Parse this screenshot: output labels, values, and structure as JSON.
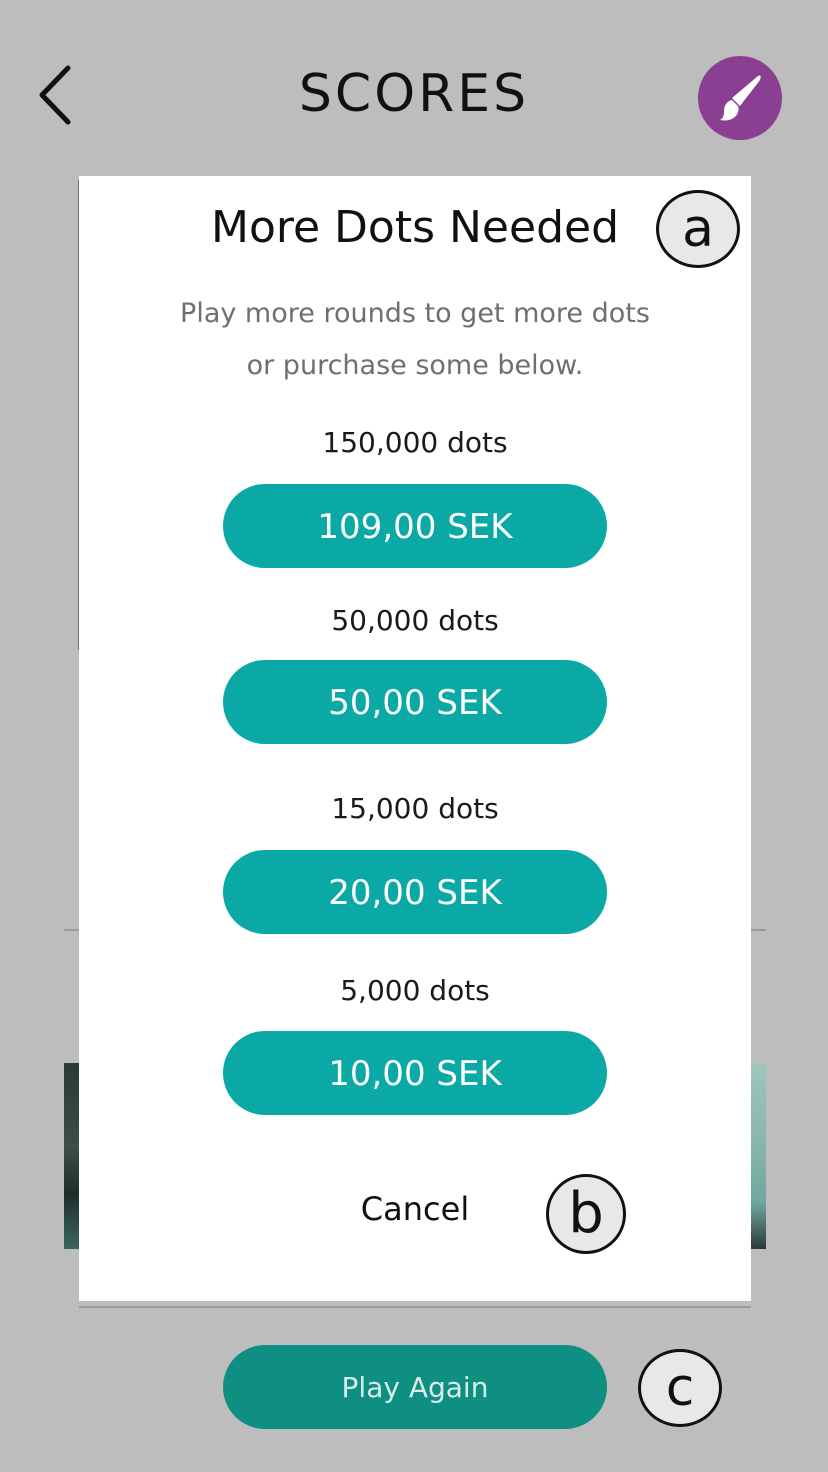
{
  "header": {
    "title": "SCORES",
    "back_icon": "chevron-left-icon",
    "brush_icon": "paintbrush-icon",
    "brush_color": "#8a3f93"
  },
  "modal": {
    "title": "More Dots Needed",
    "subtitle_line1": "Play more rounds to get more dots",
    "subtitle_line2": "or purchase some below.",
    "packages": [
      {
        "dots": "150,000 dots",
        "price": "109,00 SEK"
      },
      {
        "dots": "50,000 dots",
        "price": "50,00 SEK"
      },
      {
        "dots": "15,000 dots",
        "price": "20,00 SEK"
      },
      {
        "dots": "5,000 dots",
        "price": "10,00 SEK"
      }
    ],
    "cancel_label": "Cancel",
    "button_color": "#0aa9a5"
  },
  "footer": {
    "play_again_label": "Play Again"
  },
  "markers": {
    "a": "a",
    "b": "b",
    "c": "c"
  }
}
